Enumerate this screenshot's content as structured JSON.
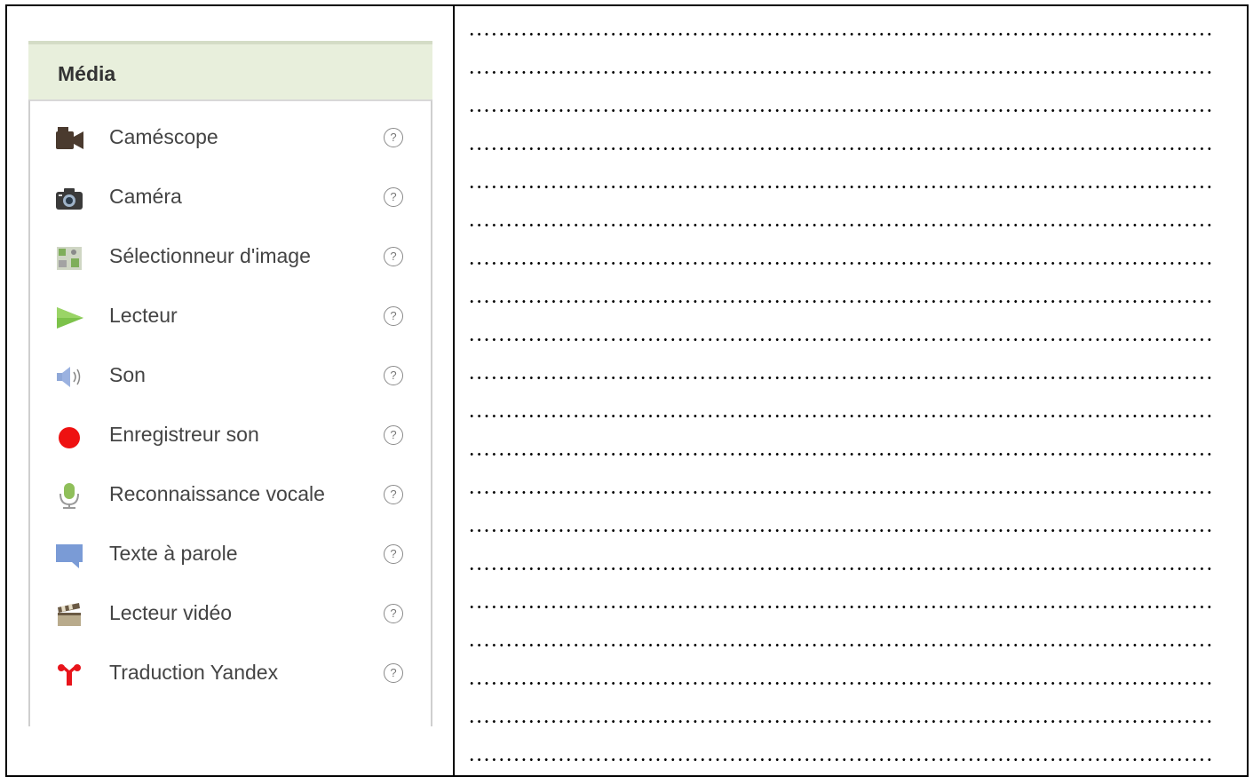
{
  "palette": {
    "title": "Média",
    "help_glyph": "?",
    "items": [
      {
        "label": "Caméscope",
        "icon": "camcorder-icon"
      },
      {
        "label": "Caméra",
        "icon": "camera-icon"
      },
      {
        "label": "Sélectionneur d'image",
        "icon": "image-picker-icon"
      },
      {
        "label": "Lecteur",
        "icon": "play-icon"
      },
      {
        "label": "Son",
        "icon": "speaker-icon"
      },
      {
        "label": "Enregistreur son",
        "icon": "record-icon"
      },
      {
        "label": "Reconnaissance vocale",
        "icon": "microphone-icon"
      },
      {
        "label": "Texte à parole",
        "icon": "speech-bubble-icon"
      },
      {
        "label": "Lecteur vidéo",
        "icon": "clapperboard-icon"
      },
      {
        "label": "Traduction Yandex",
        "icon": "yandex-icon"
      }
    ]
  },
  "colors": {
    "header_bg": "#e8efdc",
    "record_red": "#ee1111",
    "play_green": "#7cc24a"
  }
}
